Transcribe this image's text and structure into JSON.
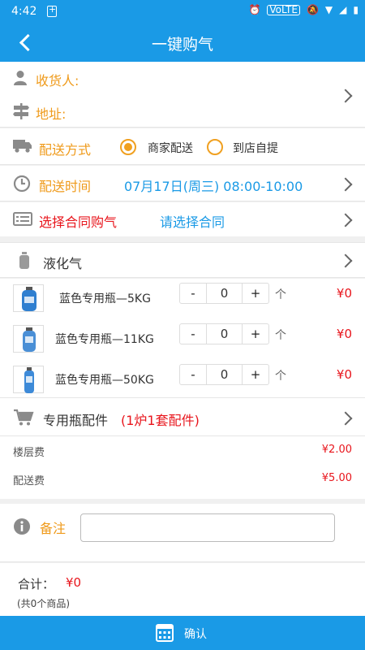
{
  "status_bar": {
    "time": "4:42",
    "volte": "VoLTE"
  },
  "nav": {
    "title": "一键购气"
  },
  "address": {
    "receiver_label": "收货人:",
    "address_label": "地址:"
  },
  "delivery_method": {
    "label": "配送方式",
    "options": [
      {
        "label": "商家配送",
        "selected": true
      },
      {
        "label": "到店自提",
        "selected": false
      }
    ]
  },
  "delivery_time": {
    "label": "配送时间",
    "value": "07月17日(周三) 08:00-10:00"
  },
  "contract": {
    "label": "选择合同购气",
    "value": "请选择合同"
  },
  "category": {
    "label": "液化气"
  },
  "products": [
    {
      "name": "蓝色专用瓶—5KG",
      "qty": "0",
      "unit": "个",
      "price": "¥0"
    },
    {
      "name": "蓝色专用瓶—11KG",
      "qty": "0",
      "unit": "个",
      "price": "¥0"
    },
    {
      "name": "蓝色专用瓶—50KG",
      "qty": "0",
      "unit": "个",
      "price": "¥0"
    }
  ],
  "stepper": {
    "minus": "-",
    "plus": "+"
  },
  "accessories": {
    "label": "专用瓶配件",
    "note": "(1炉1套配件)"
  },
  "fees": [
    {
      "label": "楼层费",
      "value": "¥2.00"
    },
    {
      "label": "配送费",
      "value": "¥5.00"
    }
  ],
  "remark": {
    "label": "备注",
    "value": ""
  },
  "summary": {
    "total_label": "合计：",
    "total_value": "¥0",
    "count_text": "(共0个商品)"
  },
  "confirm": {
    "label": "确认"
  },
  "colors": {
    "primary": "#1a9ae6",
    "accent_orange": "#ef9a1a",
    "price_red": "#e8151c"
  }
}
